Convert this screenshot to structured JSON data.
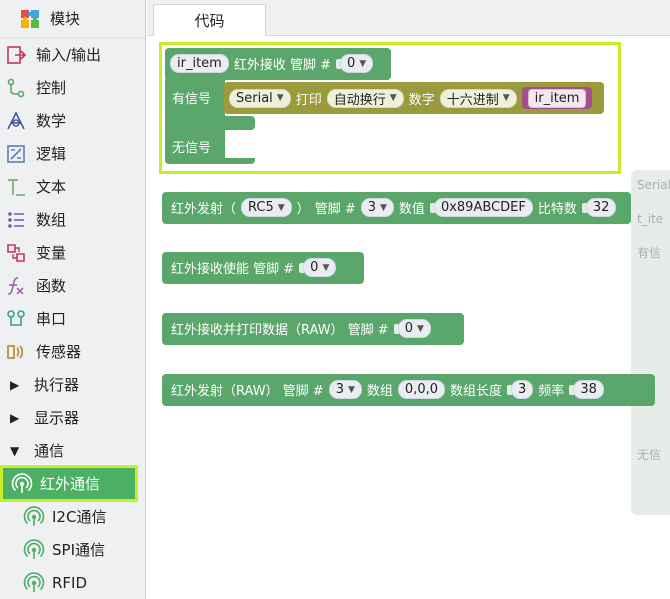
{
  "sidebar": {
    "header": {
      "label": "模块",
      "icon": "puzzle-icon"
    },
    "items": [
      {
        "label": "输入/输出",
        "icon": "io-icon"
      },
      {
        "label": "控制",
        "icon": "control-icon"
      },
      {
        "label": "数学",
        "icon": "math-icon"
      },
      {
        "label": "逻辑",
        "icon": "logic-icon"
      },
      {
        "label": "文本",
        "icon": "text-icon"
      },
      {
        "label": "数组",
        "icon": "array-icon"
      },
      {
        "label": "变量",
        "icon": "variable-icon"
      },
      {
        "label": "函数",
        "icon": "function-icon"
      },
      {
        "label": "串口",
        "icon": "serial-port-icon"
      },
      {
        "label": "传感器",
        "icon": "sensor-icon"
      },
      {
        "label": "执行器",
        "icon": "triangle-right-icon"
      },
      {
        "label": "显示器",
        "icon": "triangle-right-icon"
      },
      {
        "label": "通信",
        "icon": "triangle-down-icon"
      }
    ],
    "subitems": [
      {
        "label": "红外通信",
        "icon": "antenna-icon",
        "active": true
      },
      {
        "label": "I2C通信",
        "icon": "antenna-icon"
      },
      {
        "label": "SPI通信",
        "icon": "antenna-icon"
      },
      {
        "label": "RFID",
        "icon": "antenna-icon"
      }
    ]
  },
  "tab": {
    "label": "代码"
  },
  "blocks": {
    "ir_receive": {
      "var": "ir_item",
      "title": "红外接收 管脚 #",
      "pin": "0",
      "has_signal": "有信号",
      "no_signal": "无信号",
      "serial": {
        "port": "Serial",
        "print": "打印",
        "newline": "自动换行",
        "number": "数字",
        "format": "十六进制",
        "value": "ir_item"
      }
    },
    "ir_send": {
      "label_open": "红外发射（",
      "protocol": "RC5",
      "label_close": "）",
      "pin_label": "管脚 #",
      "pin": "3",
      "value_label": "数值",
      "value": "0x89ABCDEF",
      "bits_label": "比特数",
      "bits": "32"
    },
    "ir_enable": {
      "label": "红外接收使能 管脚 #",
      "pin": "0"
    },
    "ir_raw_print": {
      "label": "红外接收并打印数据（RAW） 管脚 #",
      "pin": "0"
    },
    "ir_raw_send": {
      "label": "红外发射（RAW） 管脚 #",
      "pin": "3",
      "array_label": "数组",
      "array": "0,0,0",
      "len_label": "数组长度",
      "len": "3",
      "freq_label": "频率",
      "freq": "38"
    }
  },
  "ghost": {
    "t1": "Serial",
    "t2": "t_ite",
    "t3": "有信",
    "t4": "无信"
  },
  "colors": {
    "block_green": "#5aa66b",
    "block_olive": "#9b9a3d",
    "block_pink": "#a54e8f",
    "highlight": "#c6ef2a"
  }
}
